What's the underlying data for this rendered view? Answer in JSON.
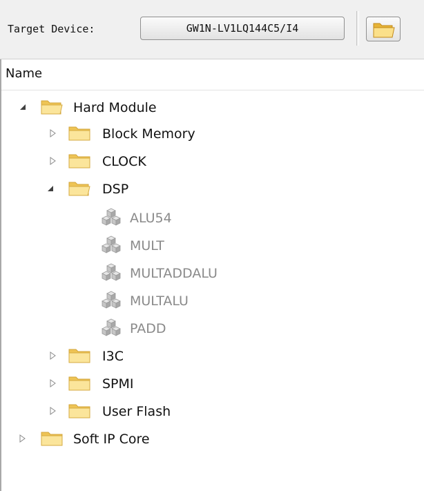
{
  "toolbar": {
    "target_label": "Target Device:",
    "device": "GW1N-LV1LQ144C5/I4"
  },
  "header": {
    "name": "Name"
  },
  "tree": {
    "hard_module": "Hard Module",
    "block_memory": "Block Memory",
    "clock": "CLOCK",
    "dsp": "DSP",
    "alu54": "ALU54",
    "mult": "MULT",
    "multaddalu": "MULTADDALU",
    "multalu": "MULTALU",
    "padd": "PADD",
    "i3c": "I3C",
    "spmi": "SPMI",
    "user_flash": "User Flash",
    "soft_ip_core": "Soft IP Core"
  },
  "icons": {
    "expanded": "triangle-down-icon",
    "collapsed": "triangle-right-icon",
    "folder_open": "folder-open-icon",
    "folder_closed": "folder-icon",
    "leaf": "cubes-icon"
  },
  "colors": {
    "folder_fill": "#f5d26a",
    "folder_front": "#fbe59b",
    "leaf_text": "#8a8a8a",
    "toolbar_bg": "#f0f0f0"
  }
}
